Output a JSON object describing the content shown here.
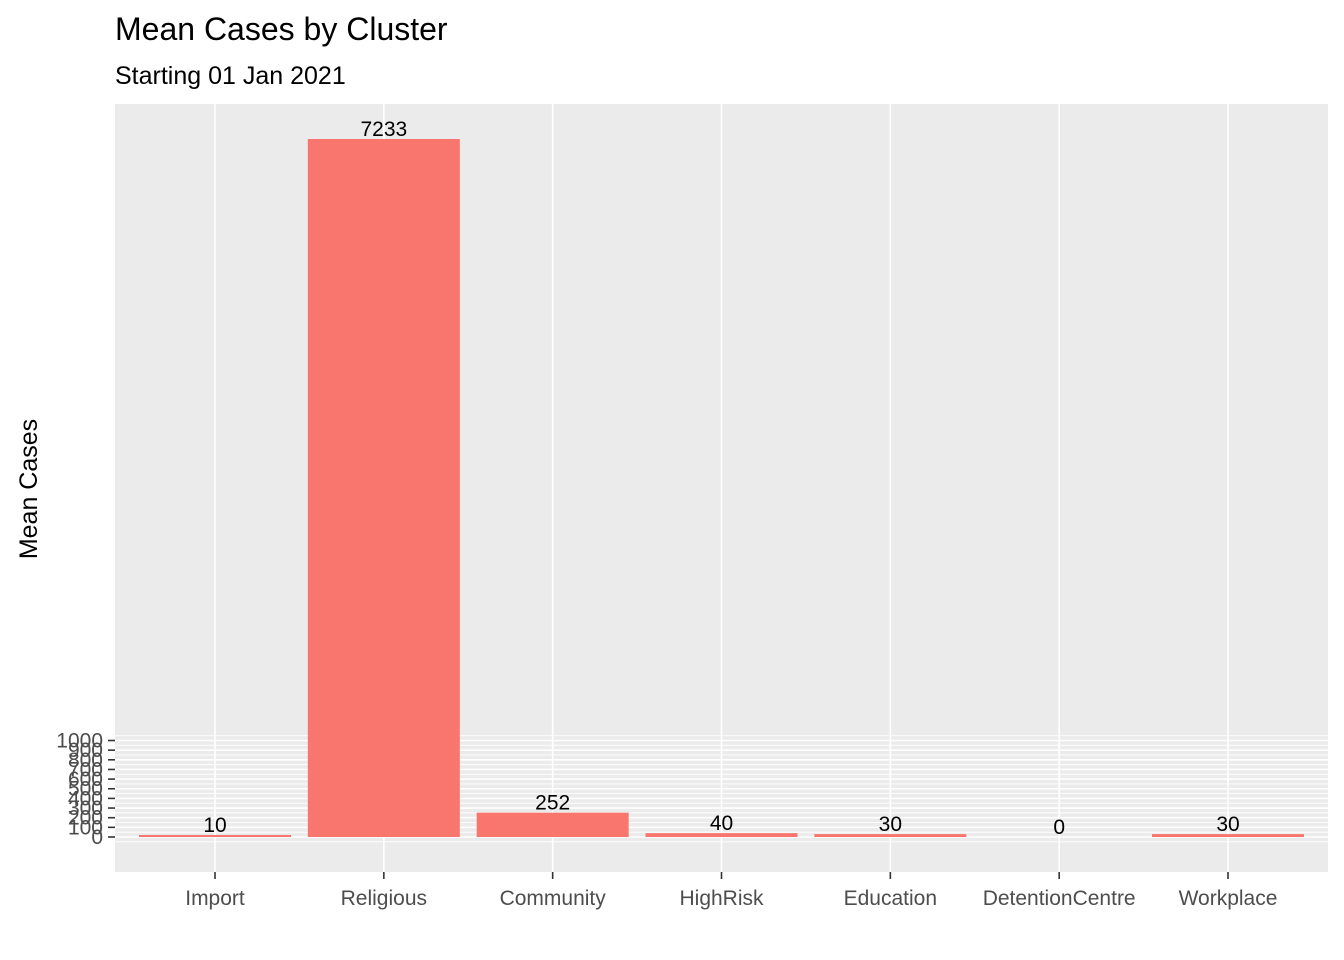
{
  "chart_data": {
    "type": "bar",
    "title": "Mean Cases by Cluster",
    "subtitle": "Starting 01 Jan 2021",
    "xlabel": "",
    "ylabel": "Mean Cases",
    "categories": [
      "Import",
      "Religious",
      "Community",
      "HighRisk",
      "Education",
      "DetentionCentre",
      "Workplace"
    ],
    "values": [
      10,
      7233,
      252,
      40,
      30,
      0,
      30
    ],
    "data_labels": [
      "10",
      "7233",
      "252",
      "40",
      "30",
      "0",
      "30"
    ],
    "y_ticks": [
      0,
      100,
      200,
      300,
      400,
      500,
      600,
      700,
      800,
      900,
      1000
    ],
    "y_tick_labels": [
      "0",
      "100",
      "200",
      "300",
      "400",
      "500",
      "600",
      "700",
      "800",
      "900",
      "1000"
    ],
    "ylim": [
      -350,
      7600
    ],
    "grid": true,
    "legend": "none",
    "colors": {
      "bar": "#F8766D",
      "panel": "#EBEBEB",
      "grid": "#FFFFFF",
      "tick_text": "#4D4D4D",
      "tick_mark": "#333333"
    }
  }
}
